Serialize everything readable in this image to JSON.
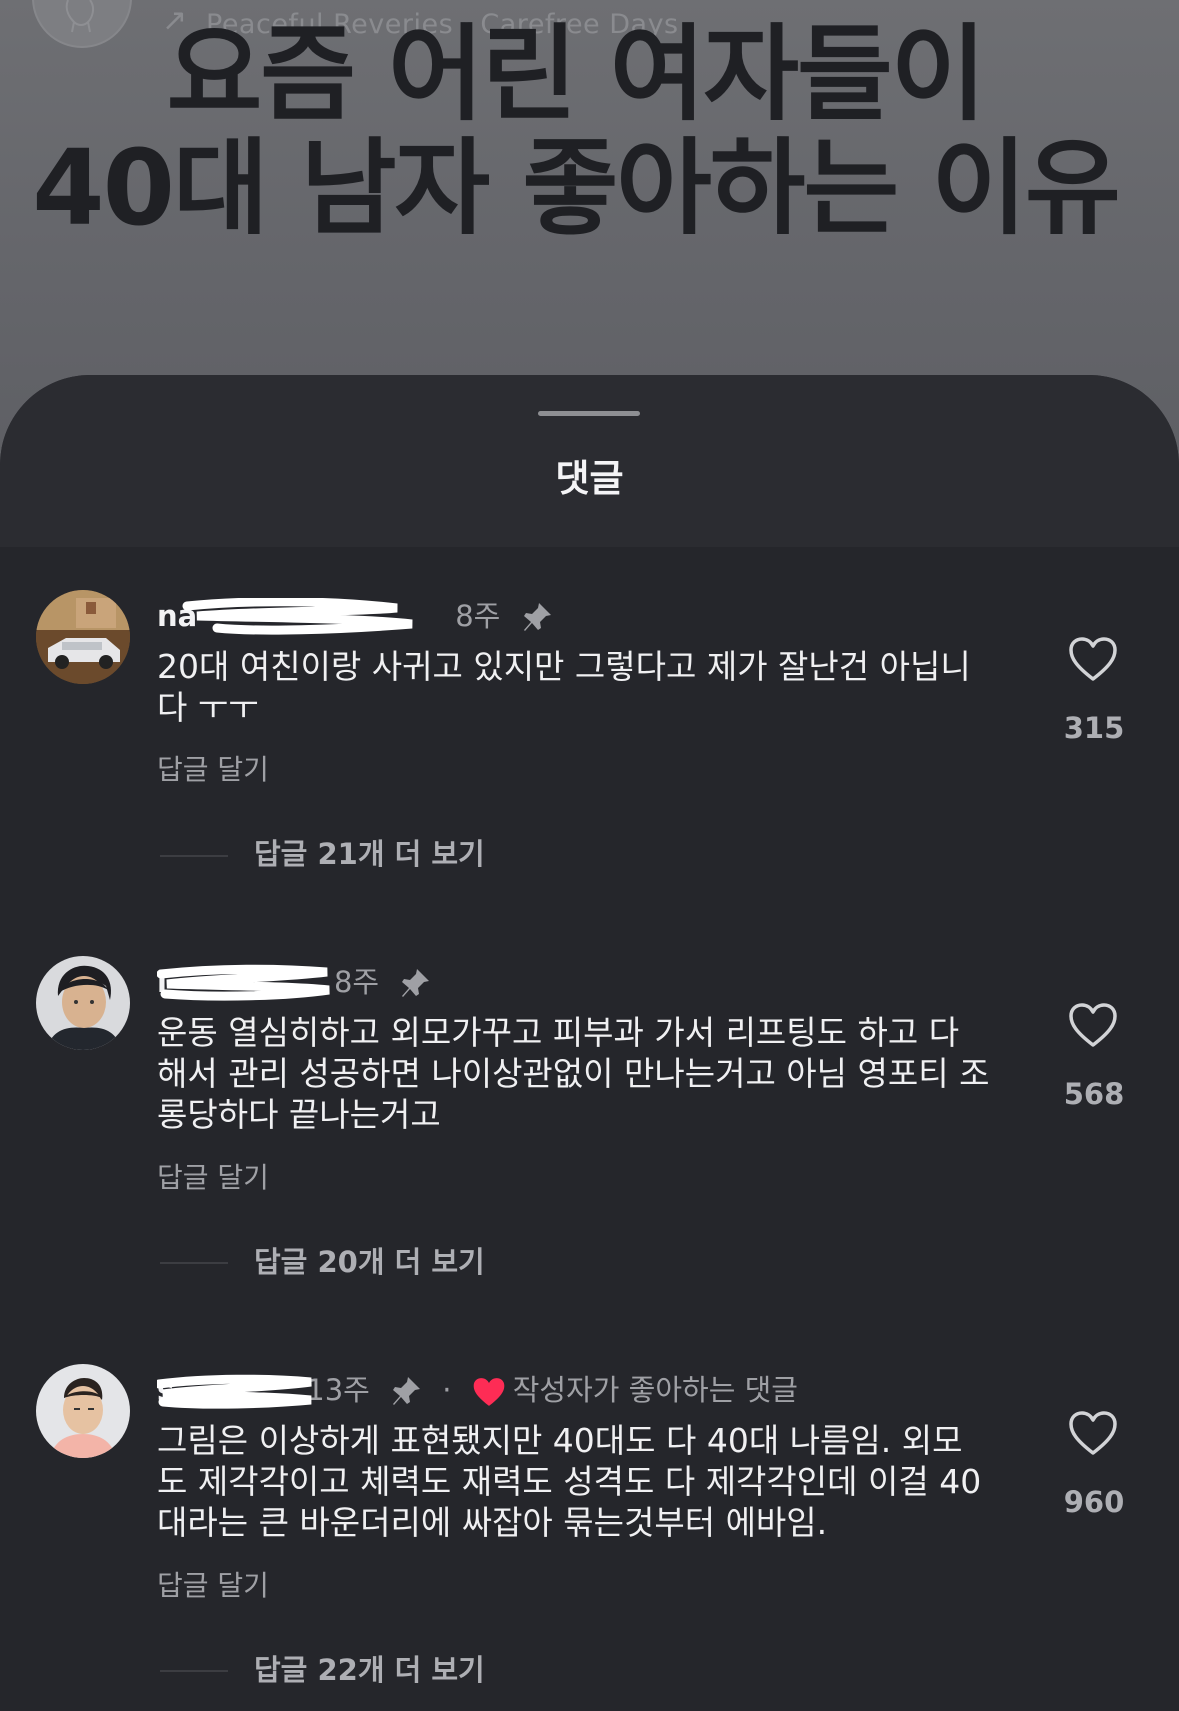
{
  "background_post": {
    "meta": "Peaceful Reveries · Carefree Days",
    "title_line1": "요즘 어린 여자들이",
    "title_line2": "40대 남자 좋아하는 이유"
  },
  "sheet": {
    "title": "댓글"
  },
  "comments": [
    {
      "username": "na",
      "time": "8주",
      "text": "20대 여친이랑 사귀고 있지만 그렇다고 제가 잘난건 아닙니\n다 ㅜㅜ",
      "reply_label": "답글 달기",
      "more_replies": "답글 21개 더 보기",
      "likes": "315"
    },
    {
      "username": "i",
      "time": "8주",
      "text": "운동 열심히하고 외모가꾸고 피부과 가서 리프팅도 하고 다\n해서 관리 성공하면 나이상관없이 만나는거고 아님 영포티 조\n롱당하다 끝나는거고",
      "reply_label": "답글 달기",
      "more_replies": "답글 20개 더 보기",
      "likes": "568"
    },
    {
      "username": "s",
      "time": "13주",
      "author_liked": "작성자가 좋아하는 댓글",
      "text": "그림은 이상하게 표현됐지만 40대도 다 40대 나름임. 외모\n도 제각각이고 체력도 재력도 성격도 다 제각각인데 이걸 40\n대라는 큰 바운더리에 싸잡아 묶는것부터 에바임.",
      "reply_label": "답글 달기",
      "more_replies": "답글 22개 더 보기",
      "likes": "960"
    }
  ],
  "colors": {
    "heart_red": "#fe2c55",
    "sheet_bg": "#25262b",
    "text_primary": "#f0f0f2",
    "text_secondary": "#9fa0a5"
  },
  "icons": [
    "pin-icon",
    "heart-icon",
    "arrow-icon",
    "avatar-placeholder-icon"
  ]
}
